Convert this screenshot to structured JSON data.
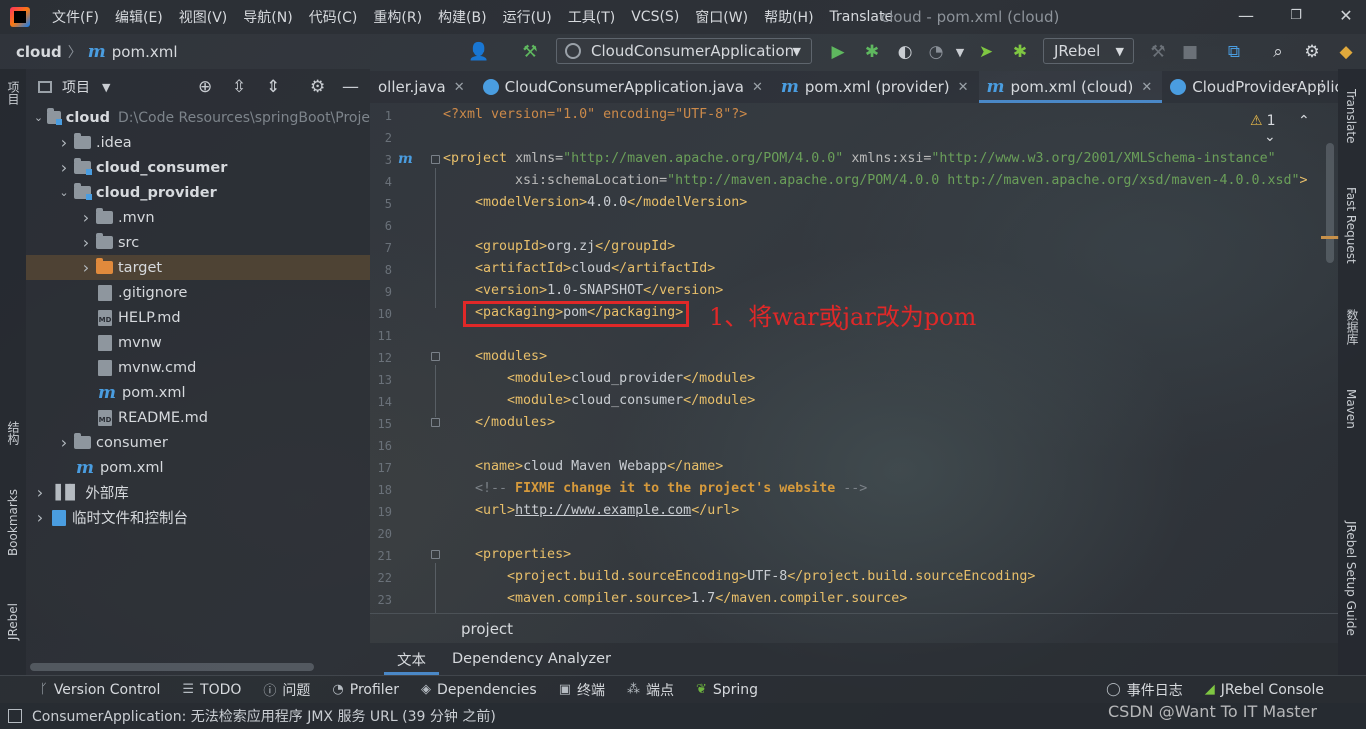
{
  "window": {
    "title": "cloud - pom.xml (cloud)",
    "menu": [
      "文件(F)",
      "编辑(E)",
      "视图(V)",
      "导航(N)",
      "代码(C)",
      "重构(R)",
      "构建(B)",
      "运行(U)",
      "工具(T)",
      "VCS(S)",
      "窗口(W)",
      "帮助(H)",
      "Translate"
    ]
  },
  "nav": {
    "project": "cloud",
    "file": "pom.xml",
    "run_config": "CloudConsumerApplication",
    "jrebel": "JRebel"
  },
  "left_strip": {
    "project": "项目",
    "structure": "结构",
    "bookmarks": "Bookmarks",
    "jrebel": "JRebel"
  },
  "project_panel": {
    "title": "项目",
    "tree": [
      {
        "label": "cloud",
        "path": "D:\\Code Resources\\springBoot\\Proje",
        "level": 0,
        "expanded": true,
        "kind": "module",
        "bold": true
      },
      {
        "label": ".idea",
        "level": 1,
        "expanded": false,
        "kind": "folder"
      },
      {
        "label": "cloud_consumer",
        "level": 1,
        "expanded": false,
        "kind": "module",
        "bold": true
      },
      {
        "label": "cloud_provider",
        "level": 1,
        "expanded": true,
        "kind": "module",
        "bold": true
      },
      {
        "label": ".mvn",
        "level": 2,
        "expanded": false,
        "kind": "folder"
      },
      {
        "label": "src",
        "level": 2,
        "expanded": false,
        "kind": "folder"
      },
      {
        "label": "target",
        "level": 2,
        "expanded": false,
        "kind": "folder-orange",
        "selected": true
      },
      {
        "label": ".gitignore",
        "level": 2,
        "kind": "file"
      },
      {
        "label": "HELP.md",
        "level": 2,
        "kind": "md"
      },
      {
        "label": "mvnw",
        "level": 2,
        "kind": "file"
      },
      {
        "label": "mvnw.cmd",
        "level": 2,
        "kind": "file"
      },
      {
        "label": "pom.xml",
        "level": 2,
        "kind": "maven"
      },
      {
        "label": "README.md",
        "level": 2,
        "kind": "md"
      },
      {
        "label": "consumer",
        "level": 1,
        "expanded": false,
        "kind": "folder"
      },
      {
        "label": "pom.xml",
        "level": 1,
        "kind": "maven"
      },
      {
        "label": "外部库",
        "level": 0,
        "expanded": false,
        "kind": "lib"
      },
      {
        "label": "临时文件和控制台",
        "level": 0,
        "expanded": false,
        "kind": "scratch"
      }
    ]
  },
  "tabs": [
    {
      "label": "oller.java",
      "icon": "class",
      "active": false
    },
    {
      "label": "CloudConsumerApplication.java",
      "icon": "class",
      "active": false
    },
    {
      "label": "pom.xml (provider)",
      "icon": "maven",
      "active": false
    },
    {
      "label": "pom.xml (cloud)",
      "icon": "maven",
      "active": true
    },
    {
      "label": "CloudProviderApplicati",
      "icon": "class",
      "active": false
    }
  ],
  "editor": {
    "warning_count": "1",
    "lines": [
      "1",
      "2",
      "3",
      "4",
      "5",
      "6",
      "7",
      "8",
      "9",
      "10",
      "11",
      "12",
      "13",
      "14",
      "15",
      "16",
      "17",
      "18",
      "19",
      "20",
      "21",
      "22",
      "23"
    ],
    "code": {
      "l1": "<?xml version=\"1.0\" encoding=\"UTF-8\"?>",
      "l3_a": "<project ",
      "l3_b": "xmlns=",
      "l3_c": "\"http://maven.apache.org/POM/4.0.0\"",
      "l3_d": " xmlns:xsi=",
      "l3_e": "\"http://www.w3.org/2001/XMLSchema-instance\"",
      "l4_a": "xsi:schemaLocation=",
      "l4_b": "\"http://maven.apache.org/POM/4.0.0 http://maven.apache.org/xsd/maven-4.0.0.xsd\"",
      "l4_c": ">",
      "l5_tag": "modelVersion",
      "l5_val": "4.0.0",
      "l7_tag": "groupId",
      "l7_val": "org.zj",
      "l8_tag": "artifactId",
      "l8_val": "cloud",
      "l9_tag": "version",
      "l9_val": "1.0-SNAPSHOT",
      "l10_tag": "packaging",
      "l10_val": "pom",
      "l12_tag": "modules",
      "l13_tag": "module",
      "l13_val": "cloud_provider",
      "l14_tag": "module",
      "l14_val": "cloud_consumer",
      "l17_tag": "name",
      "l17_val": "cloud Maven Webapp",
      "l18_open": "<!-- ",
      "l18_todo": "FIXME change it to the project's website",
      "l18_close": " -->",
      "l19_tag": "url",
      "l19_val": "http://www.example.com",
      "l21_tag": "properties",
      "l22_tag": "project.build.sourceEncoding",
      "l22_val": "UTF-8",
      "l23_tag": "maven.compiler.source",
      "l23_val": "1.7"
    },
    "annotation": "1、将war或jar改为pom"
  },
  "breadcrumb": "project",
  "sub_tabs": [
    "文本",
    "Dependency Analyzer"
  ],
  "right_strip": {
    "translate": "Translate",
    "fast_request": "Fast Request",
    "database": "数据库",
    "maven": "Maven",
    "jrebel_guide": "JRebel Setup Guide"
  },
  "tool_windows": {
    "left": [
      "Version Control",
      "TODO",
      "问题",
      "Profiler",
      "Dependencies",
      "终端",
      "端点",
      "Spring"
    ],
    "right": [
      "事件日志",
      "JRebel Console"
    ]
  },
  "status": {
    "message": "ConsumerApplication: 无法检索应用程序 JMX 服务 URL (39 分钟 之前)",
    "watermark": "CSDN @Want To IT Master"
  }
}
